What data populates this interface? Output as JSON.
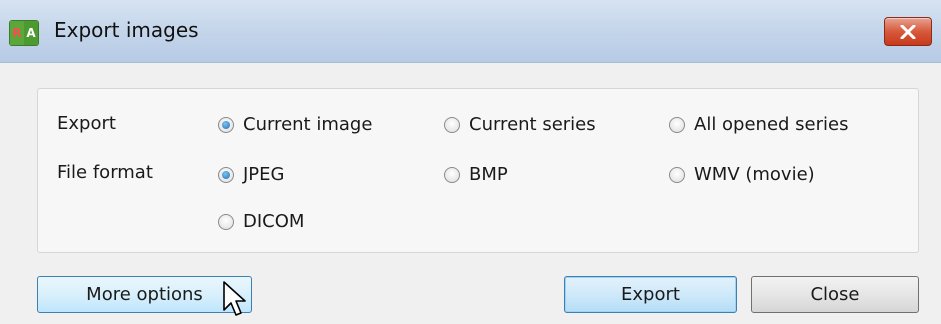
{
  "window": {
    "title": "Export images",
    "app_icon_left": "R",
    "app_icon_right": "A"
  },
  "export_row": {
    "label": "Export",
    "options": [
      {
        "label": "Current image",
        "selected": true
      },
      {
        "label": "Current series",
        "selected": false
      },
      {
        "label": "All opened series",
        "selected": false
      }
    ]
  },
  "format_row": {
    "label": "File format",
    "options": [
      {
        "label": "JPEG",
        "selected": true
      },
      {
        "label": "BMP",
        "selected": false
      },
      {
        "label": "WMV (movie)",
        "selected": false
      },
      {
        "label": "DICOM",
        "selected": false
      }
    ]
  },
  "buttons": {
    "more_options": "More options",
    "export": "Export",
    "close": "Close"
  },
  "icons": {
    "app": "radiant-app-icon",
    "close": "close-icon",
    "cursor": "mouse-pointer-icon"
  },
  "colors": {
    "titlebar": "#c3d4ea",
    "close_button": "#d7593c",
    "radio_selected": "#1e6fb8",
    "button_highlight": "#bee6fd"
  }
}
